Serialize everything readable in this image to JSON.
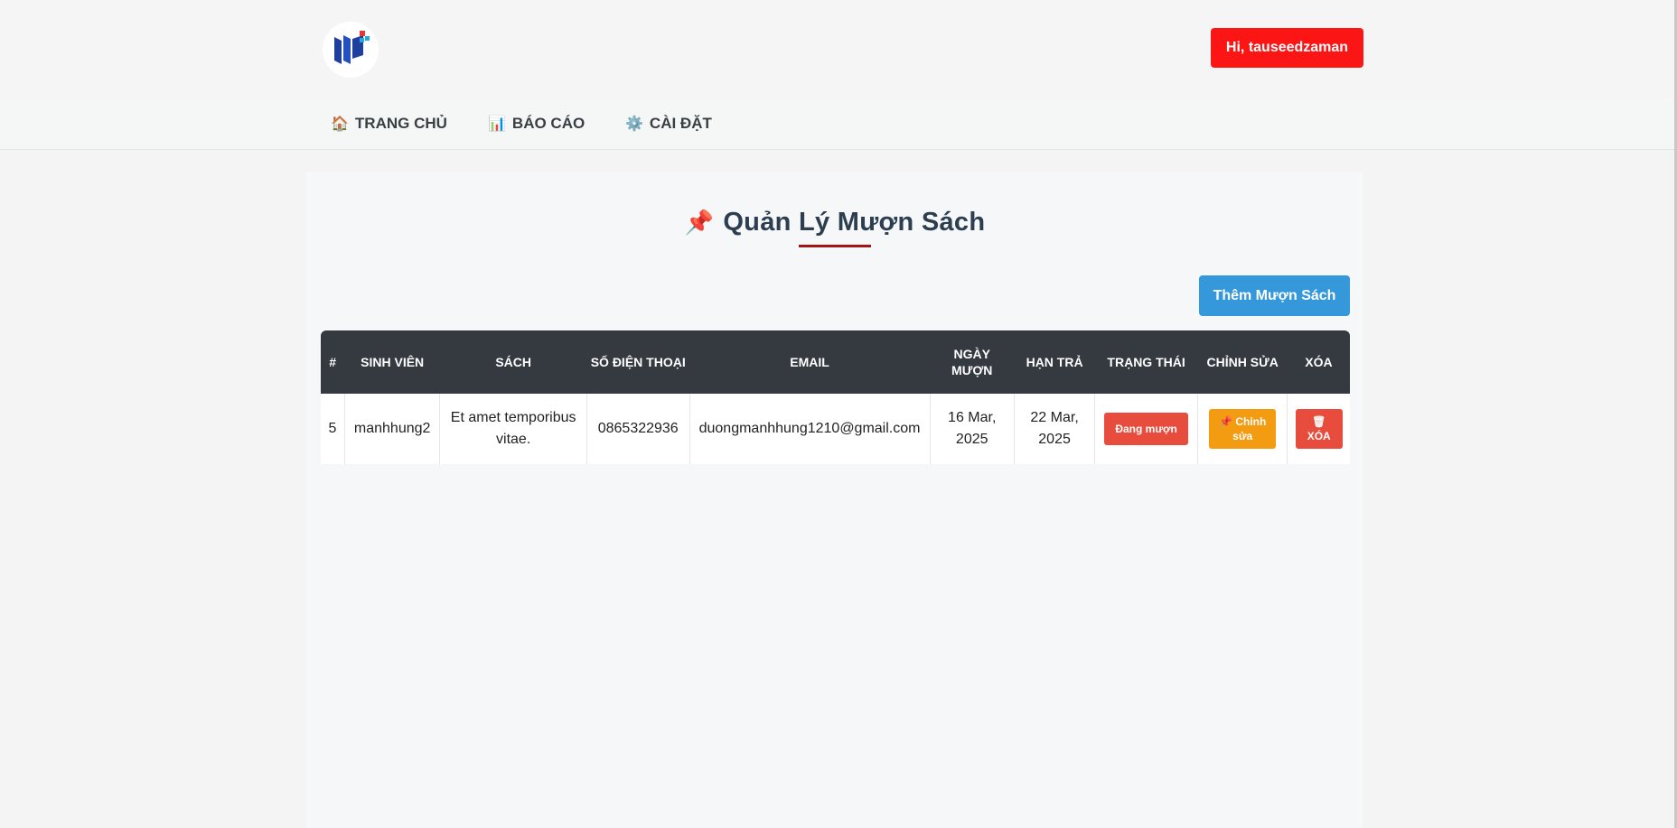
{
  "header": {
    "user_button": "Hi, tauseedzaman"
  },
  "nav": {
    "home": "TRANG CHỦ",
    "report": "BÁO CÁO",
    "settings": "CÀI ĐẶT"
  },
  "page": {
    "title": "Quản Lý Mượn Sách",
    "add_button": "Thêm Mượn Sách"
  },
  "table": {
    "columns": [
      "#",
      "SINH VIÊN",
      "SÁCH",
      "SỐ ĐIỆN THOẠI",
      "EMAIL",
      "NGÀY MƯỢN",
      "HẠN TRẢ",
      "TRẠNG THÁI",
      "CHỈNH SỬA",
      "XÓA"
    ],
    "rows": [
      {
        "id": "5",
        "student": "manhhung2",
        "book": "Et amet temporibus vitae.",
        "phone": "0865322936",
        "email": "duongmanhhung1210@gmail.com",
        "borrow_date": "16 Mar, 2025",
        "due_date": "22 Mar, 2025",
        "status": "Đang mượn",
        "edit_label": "Chỉnh sửa",
        "delete_label": "XÓA"
      }
    ]
  },
  "icons": {
    "home": "home-icon",
    "report": "bar-chart-icon",
    "settings": "gear-icon",
    "title": "pushpin-icon",
    "edit": "pushpin-icon",
    "delete": "trash-icon"
  },
  "colors": {
    "user_button": "#fb1515",
    "add_button": "#3498db",
    "table_header": "#343a40",
    "status_badge": "#e74c3c",
    "edit_button": "#f39c12",
    "delete_button": "#e74c3c"
  }
}
